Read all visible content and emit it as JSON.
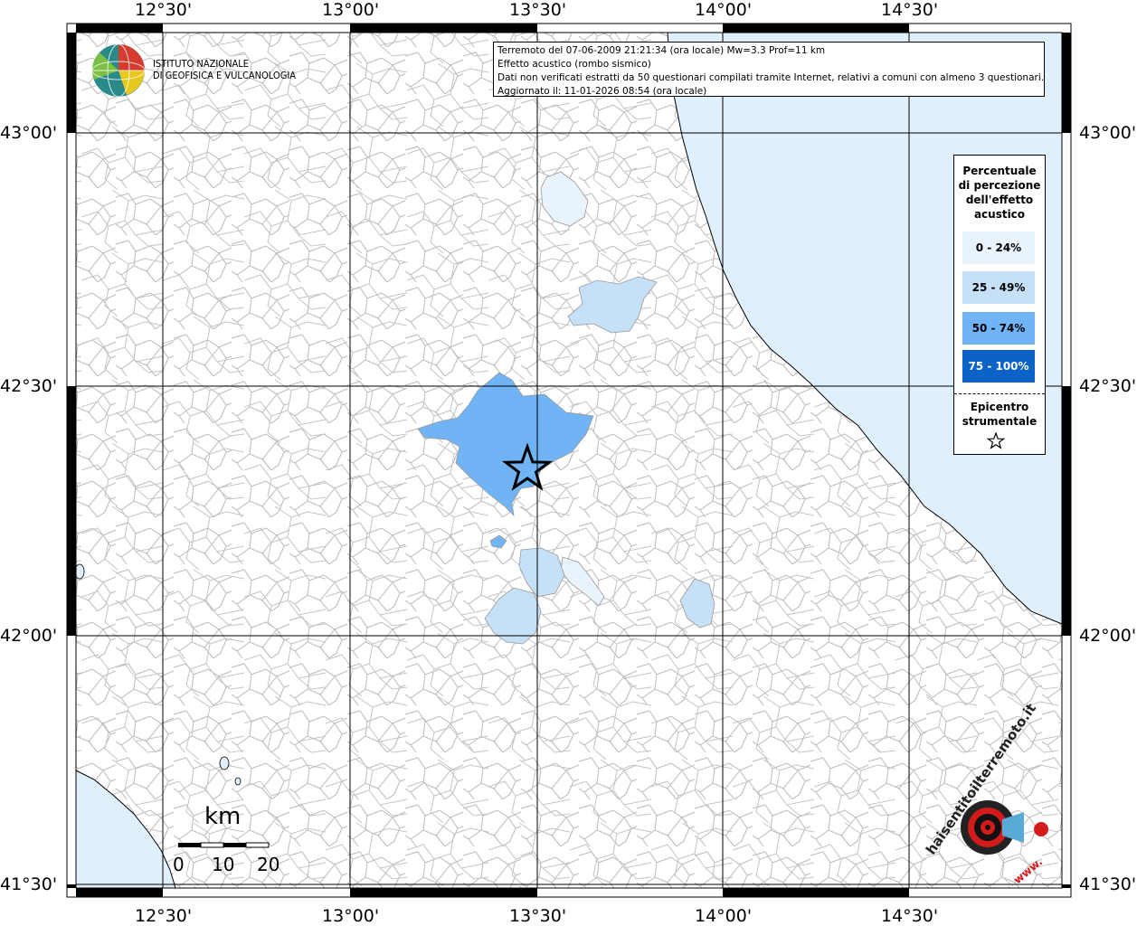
{
  "map": {
    "longitude_labels": [
      "12°30'",
      "13°00'",
      "13°30'",
      "14°00'",
      "14°30'"
    ],
    "latitude_labels": [
      "43°00'",
      "42°30'",
      "42°00'",
      "41°30'"
    ]
  },
  "info": {
    "line1": "Terremoto del 07-06-2009 21:21:34 (ora locale) Mw=3.3 Prof=11 km",
    "line2": "Effetto acustico (rombo sismico)",
    "line3": "Dati non verificati estratti da 50 questionari compilati tramite Internet, relativi a comuni con almeno 3 questionari.",
    "line4": "Aggiornato il: 11-01-2026 08:54 (ora locale)"
  },
  "logo": {
    "line1": "ISTITUTO NAZIONALE",
    "line2": "DI GEOFISICA E VULCANOLOGIA"
  },
  "legend": {
    "title_lines": [
      "Percentuale",
      "di percezione",
      "dell'effetto",
      "acustico"
    ],
    "classes": [
      {
        "label": "0 - 24%",
        "color": "#e8f3fc",
        "text_color": "#000000"
      },
      {
        "label": "25 - 49%",
        "color": "#c6e0f8",
        "text_color": "#000000"
      },
      {
        "label": "50 - 74%",
        "color": "#70b4f5",
        "text_color": "#000000"
      },
      {
        "label": "75 - 100%",
        "color": "#0b63c7",
        "text_color": "#ffffff"
      }
    ],
    "epicenter_lines": [
      "Epicentro",
      "strumentale"
    ]
  },
  "scale_bar": {
    "unit": "km",
    "labels": [
      "0",
      "10",
      "20"
    ]
  },
  "brand": {
    "text": "haisentitoilterremoto.it",
    "www": "www."
  },
  "colors": {
    "sea": "#dff0fc",
    "land": "#ffffff",
    "borders": "#b4b4b4",
    "grid": "#000000"
  }
}
